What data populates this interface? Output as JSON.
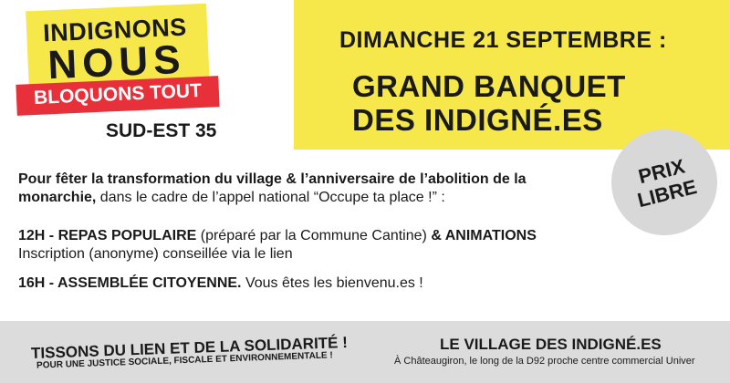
{
  "logo": {
    "line1": "INDIGNONS",
    "line2": "NOUS",
    "tagline": "BLOQUONS TOUT",
    "region": "SUD-EST 35"
  },
  "event": {
    "date": "DIMANCHE 21 SEPTEMBRE :",
    "title_line1": "GRAND BANQUET",
    "title_line2": "DES INDIGNÉ.ES"
  },
  "price_badge": {
    "line1": "PRIX",
    "line2": "LIBRE"
  },
  "intro": {
    "bold": "Pour fêter la transformation du village & l’anniversaire de l’abolition de la monarchie,",
    "normal": " dans le cadre de l’appel national “Occupe ta place !” :"
  },
  "schedule": [
    {
      "time_title": "12H - REPAS POPULAIRE",
      "detail": " (préparé par la Commune Cantine) ",
      "extra_bold": "& ANIMATIONS",
      "note": "Inscription (anonyme) conseillée via le lien"
    },
    {
      "time_title": "16H - ASSEMBLÉE CITOYENNE.",
      "detail": " Vous êtes les bienvenu.es !"
    }
  ],
  "footer": {
    "left_main": "TISSONS DU LIEN ET DE LA SOLIDARITÉ !",
    "left_sub": "POUR UNE JUSTICE SOCIALE, FISCALE ET ENVIRONNEMENTALE !",
    "right_main": "LE VILLAGE DES INDIGNÉ.ES",
    "right_sub": "À Châteaugiron, le long de la D92 proche centre commercial Univer"
  },
  "colors": {
    "yellow": "#f6e84a",
    "red": "#e8303a",
    "grey": "#dcdcdc",
    "badge": "#d8d8d8"
  }
}
